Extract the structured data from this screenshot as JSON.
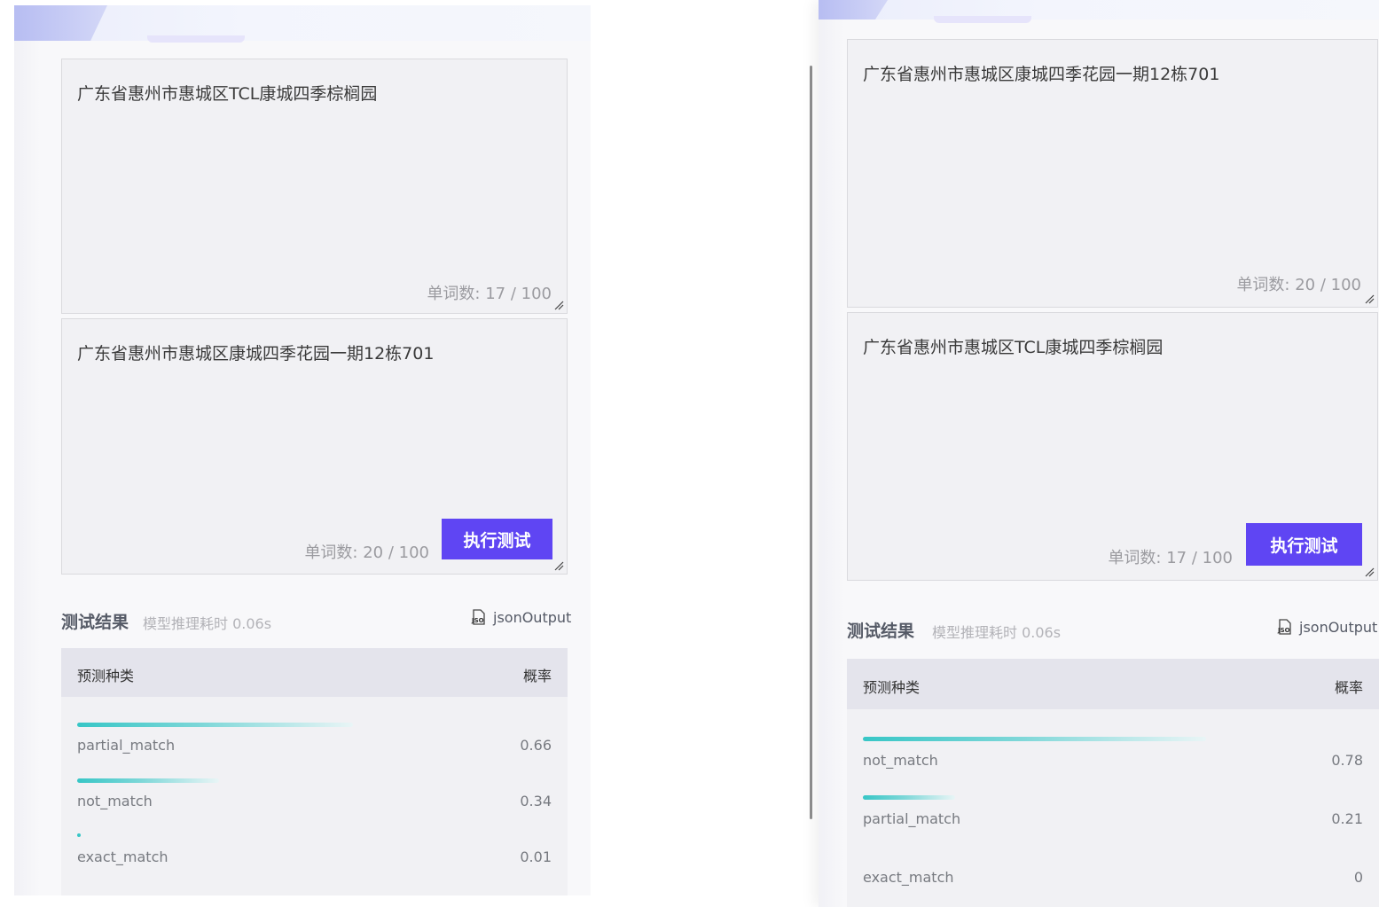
{
  "left": {
    "input1": {
      "text": "广东省惠州市惠城区TCL康城四季棕榈园",
      "count": "单词数: 17 / 100"
    },
    "input2": {
      "text": "广东省惠州市惠城区康城四季花园一期12栋701",
      "count": "单词数: 20 / 100"
    },
    "run_button": "执行测试",
    "results": {
      "title": "测试结果",
      "subtitle": "模型推理耗时 0.06s",
      "json_link": "jsonOutput",
      "col_class": "预测种类",
      "col_prob": "概率",
      "rows": [
        {
          "label": "partial_match",
          "value": "0.66",
          "prob": 0.66
        },
        {
          "label": "not_match",
          "value": "0.34",
          "prob": 0.34
        },
        {
          "label": "exact_match",
          "value": "0.01",
          "prob": 0.01
        }
      ]
    }
  },
  "right": {
    "input1": {
      "text": "广东省惠州市惠城区康城四季花园一期12栋701",
      "count": "单词数: 20 / 100"
    },
    "input2": {
      "text": "广东省惠州市惠城区TCL康城四季棕榈园",
      "count": "单词数: 17 / 100"
    },
    "run_button": "执行测试",
    "results": {
      "title": "测试结果",
      "subtitle": "模型推理耗时 0.06s",
      "json_link": "jsonOutput",
      "col_class": "预测种类",
      "col_prob": "概率",
      "rows": [
        {
          "label": "not_match",
          "value": "0.78",
          "prob": 0.78
        },
        {
          "label": "partial_match",
          "value": "0.21",
          "prob": 0.21
        },
        {
          "label": "exact_match",
          "value": "0",
          "prob": 0
        }
      ]
    }
  },
  "icons": {
    "resize": "resize-grip-icon",
    "json": "json-file-icon"
  },
  "colors": {
    "accent": "#5f45f3",
    "bar": "#37c6c6"
  }
}
